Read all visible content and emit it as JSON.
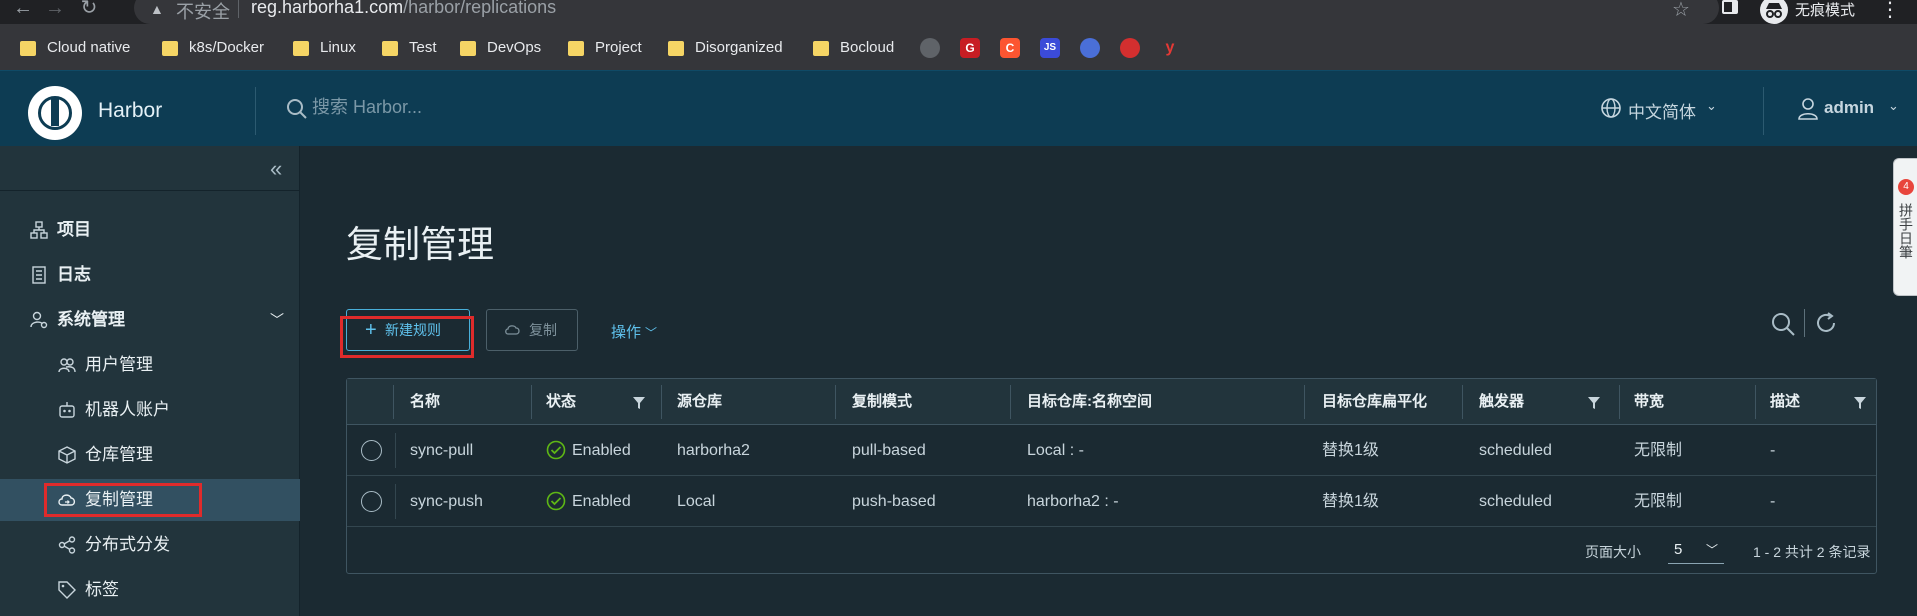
{
  "browser": {
    "security_warning": "不安全",
    "url_host": "reg.harborha1.com",
    "url_path": "/harbor/replications",
    "incognito_label": "无痕模式",
    "bookmarks": [
      "Cloud native",
      "k8s/Docker",
      "Linux",
      "Test",
      "DevOps",
      "Project",
      "Disorganized",
      "Bocloud"
    ],
    "bookmark_icons": [
      {
        "name": "github-icon",
        "glyph": "",
        "color": "#5f6368"
      },
      {
        "name": "gitee-icon",
        "glyph": "G",
        "color": "#c71d23"
      },
      {
        "name": "csdn-icon",
        "glyph": "C",
        "color": "#fc5531"
      },
      {
        "name": "js-icon",
        "glyph": "JS",
        "color": "#3b4bd8"
      },
      {
        "name": "rocket-icon",
        "glyph": "",
        "color": "#4a6fd8"
      },
      {
        "name": "octopus-icon",
        "glyph": "",
        "color": "#d32f2f"
      },
      {
        "name": "youdao-icon",
        "glyph": "y",
        "color": "#e53935"
      }
    ]
  },
  "header": {
    "app_title": "Harbor",
    "search_placeholder": "搜索 Harbor...",
    "language": "中文简体",
    "user": "admin"
  },
  "sidebar": {
    "items": [
      {
        "label": "项目",
        "icon": "project-icon"
      },
      {
        "label": "日志",
        "icon": "log-icon"
      },
      {
        "label": "系统管理",
        "icon": "system-admin-icon"
      }
    ],
    "sub_items": [
      {
        "label": "用户管理",
        "icon": "users-icon"
      },
      {
        "label": "机器人账户",
        "icon": "robot-icon"
      },
      {
        "label": "仓库管理",
        "icon": "registry-icon"
      },
      {
        "label": "复制管理",
        "icon": "cloud-replication-icon"
      },
      {
        "label": "分布式分发",
        "icon": "share-icon"
      },
      {
        "label": "标签",
        "icon": "tag-icon"
      }
    ],
    "active": "复制管理"
  },
  "main": {
    "title": "复制管理",
    "new_rule_label": "新建规则",
    "copy_label": "复制",
    "action_label": "操作"
  },
  "table": {
    "columns": [
      "名称",
      "状态",
      "源仓库",
      "复制模式",
      "目标仓库:名称空间",
      "目标仓库扁平化",
      "触发器",
      "带宽",
      "描述"
    ],
    "rows": [
      {
        "name": "sync-pull",
        "status": "Enabled",
        "source": "harborha2",
        "mode": "pull-based",
        "target": "Local : -",
        "flatten": "替换1级",
        "trigger": "scheduled",
        "bandwidth": "无限制",
        "description": "-"
      },
      {
        "name": "sync-push",
        "status": "Enabled",
        "source": "Local",
        "mode": "push-based",
        "target": "harborha2 : -",
        "flatten": "替换1级",
        "trigger": "scheduled",
        "bandwidth": "无限制",
        "description": "-"
      }
    ],
    "page_size_label": "页面大小",
    "page_size": "5",
    "summary": "1 - 2 共计 2 条记录"
  },
  "side_tab": {
    "badge": "4",
    "label": "拼手日筆"
  },
  "colors": {
    "header_bg": "#0d3c53",
    "sidebar_bg": "#22343c",
    "main_bg": "#1b2a32",
    "accent": "#49afd9",
    "success": "#5eb715",
    "highlight": "#e02b2b"
  }
}
